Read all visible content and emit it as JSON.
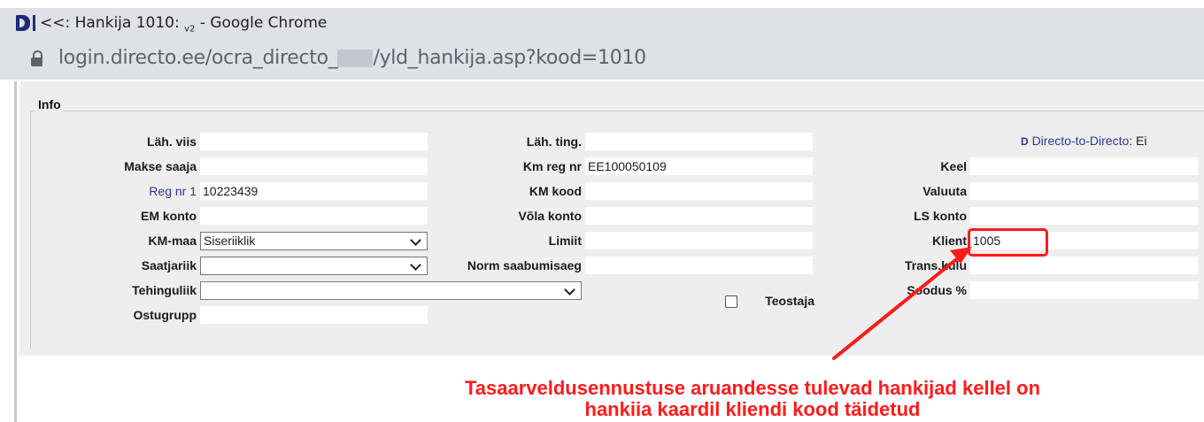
{
  "window": {
    "title": "<<: Hankija 1010:",
    "title_sub": "v2",
    "title_suffix": " - Google Chrome"
  },
  "address": {
    "url_prefix": "login.directo.ee/ocra_directo_",
    "url_suffix": "/yld_hankija.asp?kood=1010"
  },
  "form": {
    "legend": "Info",
    "col1": {
      "lah_viis_label": "Läh. viis",
      "lah_viis_value": "",
      "makse_saaja_label": "Makse saaja",
      "makse_saaja_value": "",
      "reg_nr_label": "Reg nr 1",
      "reg_nr_value": "10223439",
      "em_konto_label": "EM konto",
      "em_konto_value": "",
      "km_maa_label": "KM-maa",
      "km_maa_value": "Siseriiklik",
      "saatjariik_label": "Saatjariik",
      "saatjariik_value": "",
      "tehinguliik_label": "Tehinguliik",
      "tehinguliik_value": "",
      "ostugrupp_label": "Ostugrupp",
      "ostugrupp_value": ""
    },
    "col2": {
      "lah_ting_label": "Läh. ting.",
      "lah_ting_value": "",
      "km_reg_label": "Km reg nr",
      "km_reg_value": "EE100050109",
      "km_kood_label": "KM kood",
      "km_kood_value": "",
      "vola_konto_label": "Võla konto",
      "vola_konto_value": "",
      "limiit_label": "Limiit",
      "limiit_value": "",
      "norm_label": "Norm saabumisaeg",
      "norm_value": "",
      "teostaja_label": "Teostaja"
    },
    "col3": {
      "d2d_icon": "D",
      "d2d_label": "Directo-to-Directo",
      "d2d_value": ": Ei",
      "keel_label": "Keel",
      "keel_value": "",
      "valuuta_label": "Valuuta",
      "valuuta_value": "",
      "ls_konto_label": "LS konto",
      "ls_konto_value": "",
      "klient_label": "Klient",
      "klient_value": "1005",
      "trans_kulu_label": "Trans.kulu",
      "trans_kulu_value": "",
      "soodus_label": "Soodus %",
      "soodus_value": ""
    }
  },
  "annotation": {
    "line1": "Tasaarveldusennustuse aruandesse tulevad hankijad kellel on",
    "line2": "hankiia kaardil kliendi kood täidetud",
    "color": "#ff1a1a"
  }
}
